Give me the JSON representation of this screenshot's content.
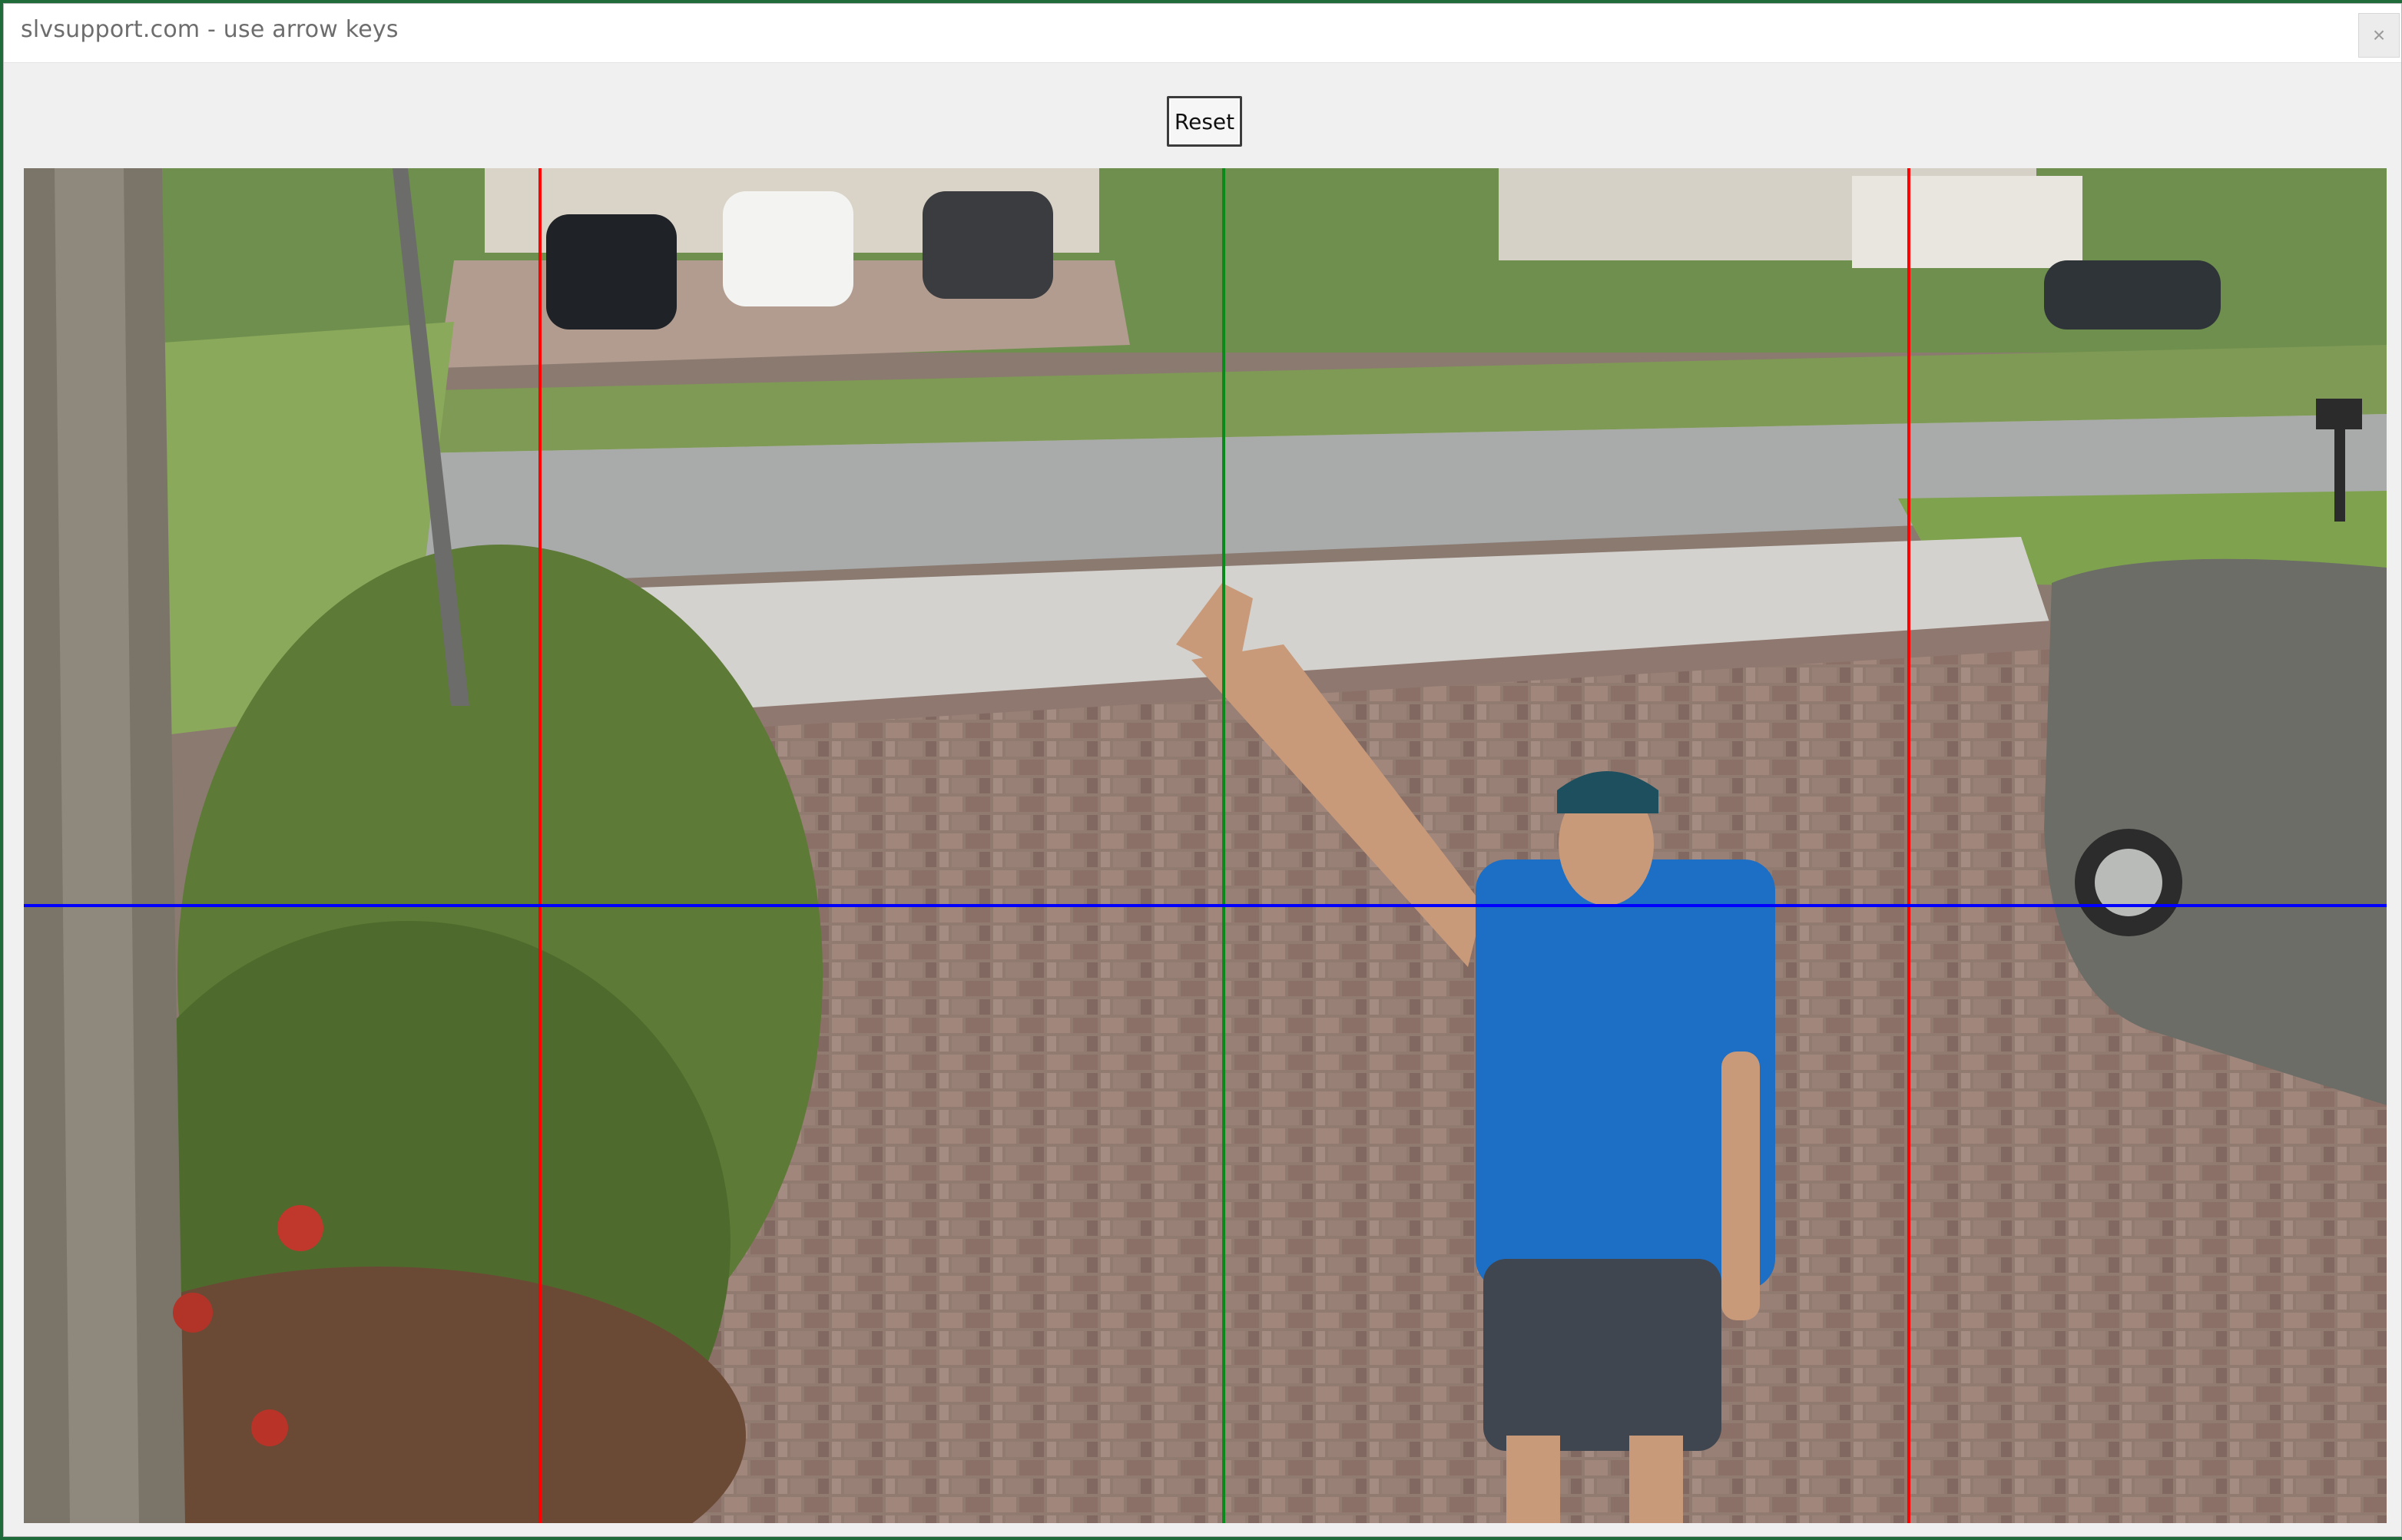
{
  "window": {
    "title": "slvsupport.com - use arrow keys",
    "close_glyph": "×"
  },
  "toolbar": {
    "reset_label": "Reset"
  },
  "guides": {
    "left_red_color": "#ff0000",
    "center_green_color": "#0a8a1a",
    "right_red_color": "#ff0000",
    "horizontal_blue_color": "#0000ff"
  },
  "scene": {
    "description_icons": [
      "tree",
      "hedges",
      "parked-cars",
      "street",
      "driveway",
      "person-waving",
      "grey-car",
      "mailbox"
    ]
  }
}
